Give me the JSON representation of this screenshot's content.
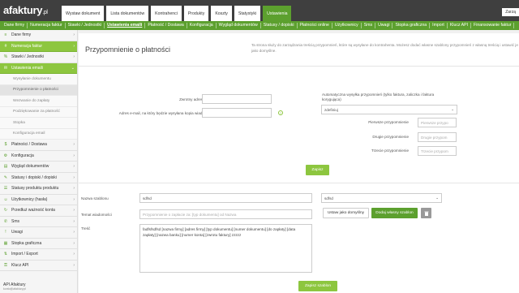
{
  "app": {
    "logo_main": "afaktury",
    "logo_tld": ".pl",
    "user": "Zarzą"
  },
  "top_nav": [
    {
      "label": "Wystaw dokument"
    },
    {
      "label": "Lista dokumentów"
    },
    {
      "label": "Kontrahenci"
    },
    {
      "label": "Produkty"
    },
    {
      "label": "Koszty"
    },
    {
      "label": "Statystyki"
    },
    {
      "label": "Ustawienia",
      "active": true
    }
  ],
  "sub_nav": [
    {
      "label": "Dane firmy"
    },
    {
      "label": "Numeracja faktur"
    },
    {
      "label": "Stawki / Jednostki"
    },
    {
      "label": "Ustawienia emaili",
      "active": true
    },
    {
      "label": "Płatność / Dostawa"
    },
    {
      "label": "Konfiguracja"
    },
    {
      "label": "Wygląd dokumentów"
    },
    {
      "label": "Statusy / dopiski"
    },
    {
      "label": "Płatności online"
    },
    {
      "label": "Użytkownicy"
    },
    {
      "label": "Sms"
    },
    {
      "label": "Uwagi"
    },
    {
      "label": "Stopka graficzna"
    },
    {
      "label": "Import"
    },
    {
      "label": "Klucz API"
    },
    {
      "label": "Finansowanie faktur"
    }
  ],
  "sidebar": {
    "items": [
      {
        "label": "Dane firmy",
        "icon": "≡"
      },
      {
        "label": "Numeracja faktur",
        "icon": "#",
        "green": true
      },
      {
        "label": "Stawki / Jednostki",
        "icon": "%"
      },
      {
        "label": "Ustawienia emaili",
        "icon": "✉",
        "green": true,
        "arrow": "⌄"
      }
    ],
    "sub_items": [
      {
        "label": "Wysyłanie dokumentu"
      },
      {
        "label": "Przypomnienie o płatności",
        "active": true
      },
      {
        "label": "Wezwanie do zapłaty"
      },
      {
        "label": "Podziękowanie za płatność"
      },
      {
        "label": "Stopka"
      },
      {
        "label": "Konfiguracja email"
      }
    ],
    "items_after": [
      {
        "label": "Płatności / Dostawa",
        "icon": "$"
      },
      {
        "label": "Konfiguracja",
        "icon": "⚙"
      },
      {
        "label": "Wygląd dokumentów",
        "icon": "▤"
      },
      {
        "label": "Statusy i dopiski / dopiski",
        "icon": "✎"
      },
      {
        "label": "Statusy produktu produktu",
        "icon": "☰"
      },
      {
        "label": "Użytkownicy (hasła)",
        "icon": "☺"
      },
      {
        "label": "Przedłuż ważność konta",
        "icon": "↻"
      },
      {
        "label": "Sms",
        "icon": "✆"
      },
      {
        "label": "Uwagi",
        "icon": "!"
      },
      {
        "label": "Stopka graficzna",
        "icon": "▦"
      },
      {
        "label": "Import / Export",
        "icon": "⇅"
      },
      {
        "label": "Klucz API",
        "icon": "⚿"
      }
    ],
    "footer": "API Afaktury",
    "footer_small": "konto@afaktury.pl"
  },
  "page": {
    "title": "Przypomnienie o płatności",
    "info": "Ta strona służy do zarządzania treścią przypomnień, które są wysyłane do kontrahenta. Możesz dodać własne szablony przypomnień z własną treścią i ustawić je jako domyślne."
  },
  "form": {
    "return_email_label": "Zwrotny adres e-mail",
    "return_email_value": "",
    "copy_email_label": "Adres e-mail, na który będzie wysyłana kopia wiadomości",
    "copy_email_value": "",
    "auto_label": "Automatyczna wysyłka przypomnień (tylko faktura, zaliczka i faktura korygująca)",
    "auto_value": "zdefiniuj",
    "first_label": "Pierwsze przypomnienie",
    "first_placeholder": "Pierwsze przypo",
    "second_label": "Drugie przypomnienie",
    "second_placeholder": "Drugie przypom",
    "third_label": "Trzecie przypomnienie",
    "third_placeholder": "Trzecie przypom",
    "save_button": "Zapisz"
  },
  "template": {
    "name_label": "Nazwa szablonu",
    "name_value": "sdfsd",
    "template_select": "sdfsd",
    "subject_label": "Temat wiadomości",
    "subject_value": "Przypomnienie o zapłacie za: [typ dokumentu] od Nazwa",
    "default_button": "Ustaw jako domyślny",
    "add_button": "Dodaj własny szablon",
    "delete_icon": "trash-icon",
    "body_label": "Treść",
    "body_value": "fadfsfsdfsd [nazwa firmy] [adres firmy] [typ dokumentu] [numer dokumentu] [do zapłaty] [data zapłaty] [nazwa banku] [numer konta] [zwrotu faktury] zzzzz",
    "save_template_button": "Zapisz szablon"
  },
  "colors": {
    "green": "#8dc63f",
    "dark_green": "#5ca02e",
    "topbar": "#3f3f3f"
  }
}
